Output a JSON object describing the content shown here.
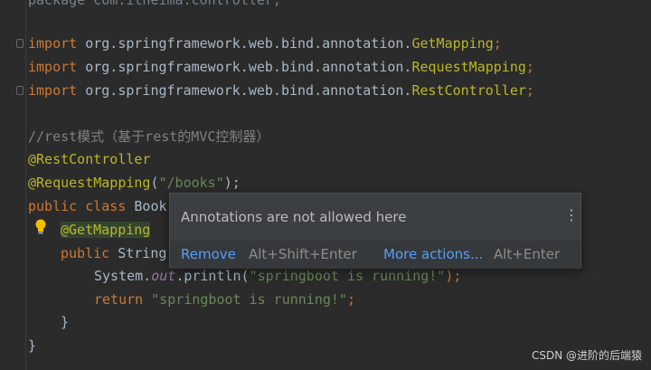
{
  "code": {
    "line0": {
      "text": "package com.itheima.controller;"
    },
    "line1": {
      "kw": "import",
      "pkg": " org.springframework.web.bind.annotation.",
      "cls": "GetMapping",
      "end": ";"
    },
    "line2": {
      "kw": "import",
      "pkg": " org.springframework.web.bind.annotation.",
      "cls": "RequestMapping",
      "end": ";"
    },
    "line3": {
      "kw": "import",
      "pkg": " org.springframework.web.bind.annotation.",
      "cls": "RestController",
      "end": ";"
    },
    "line4": {
      "comment": "//rest模式（基于rest的MVC控制器）"
    },
    "line5": {
      "ann": "@RestController"
    },
    "line6": {
      "ann": "@RequestMapping",
      "open": "(",
      "str": "\"/books\"",
      "close": ");"
    },
    "line7": {
      "kw": "public class",
      "rest": " Book"
    },
    "line8": {
      "ann": "@GetMapping"
    },
    "line9": {
      "kw": "public",
      "rest": " String"
    },
    "line10": {
      "pre": "System.",
      "italic": "out",
      "mid": ".println(",
      "str": "\"springboot is running!\"",
      "end": ");"
    },
    "line11": {
      "kw": "return",
      "str": " \"springboot is running!\"",
      "end": ";"
    },
    "line12": {
      "text": "}"
    },
    "line13": {
      "text": "}"
    }
  },
  "popup": {
    "message": "Annotations are not allowed here",
    "remove_label": "Remove",
    "remove_shortcut": "Alt+Shift+Enter",
    "more_label": "More actions...",
    "more_shortcut": "Alt+Enter",
    "menu_icon": "⋮"
  },
  "watermark": "CSDN @进阶的后端猿",
  "colors": {
    "background": "#2b2b2b",
    "keyword": "#cc7832",
    "annotation": "#bbb529",
    "string": "#6a8759",
    "comment": "#808080",
    "link": "#589df6"
  }
}
